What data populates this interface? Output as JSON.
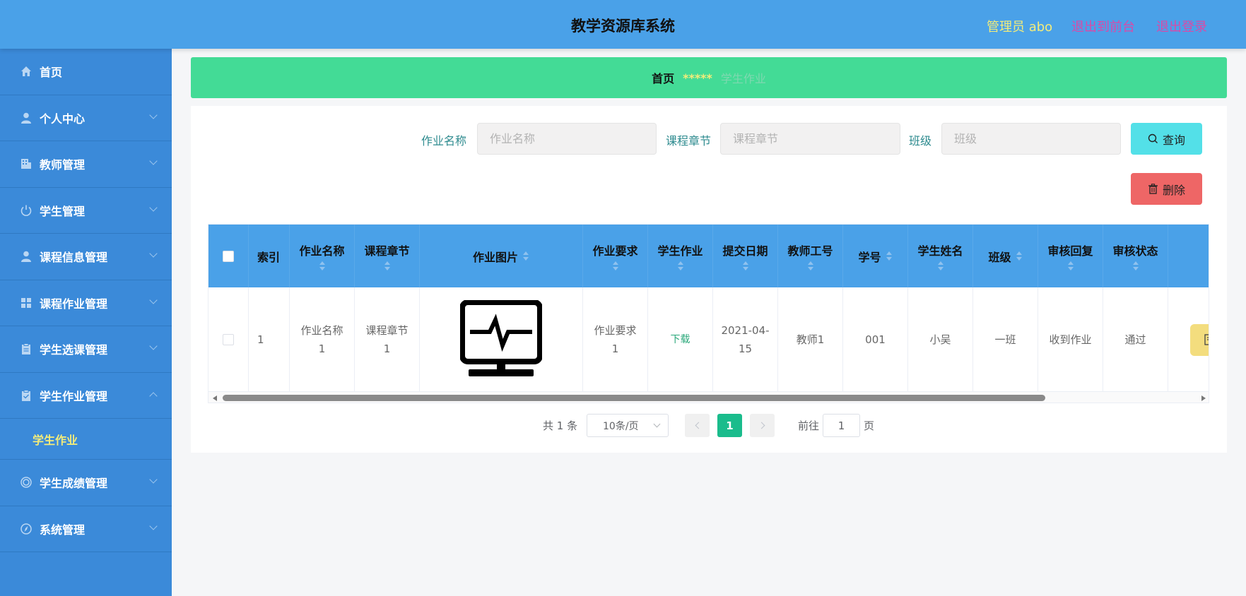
{
  "header": {
    "title": "教学资源库系统",
    "admin": "管理员 abo",
    "to_front": "退出到前台",
    "logout": "退出登录"
  },
  "sidebar": {
    "items": [
      {
        "label": "首页",
        "icon": "home-icon",
        "expanded": false,
        "has_chevron": false
      },
      {
        "label": "个人中心",
        "icon": "user-icon",
        "has_chevron": true
      },
      {
        "label": "教师管理",
        "icon": "office-icon",
        "has_chevron": true
      },
      {
        "label": "学生管理",
        "icon": "power-icon",
        "has_chevron": true
      },
      {
        "label": "课程信息管理",
        "icon": "user-icon",
        "has_chevron": true
      },
      {
        "label": "课程作业管理",
        "icon": "grid-icon",
        "has_chevron": true
      },
      {
        "label": "学生选课管理",
        "icon": "clipboard-icon",
        "has_chevron": true
      },
      {
        "label": "学生作业管理",
        "icon": "clipboard-check-icon",
        "has_chevron": true,
        "expanded": true
      },
      {
        "label": "学生成绩管理",
        "icon": "ring-icon",
        "has_chevron": true
      },
      {
        "label": "系统管理",
        "icon": "compass-icon",
        "has_chevron": true
      }
    ],
    "active_sub": "学生作业"
  },
  "breadcrumb": {
    "home": "首页",
    "sep": "*****",
    "current": "学生作业"
  },
  "search": {
    "label1": "作业名称",
    "placeholder1": "作业名称",
    "label2": "课程章节",
    "placeholder2": "课程章节",
    "label3": "班级",
    "placeholder3": "班级",
    "query_label": "查询",
    "delete_label": "删除"
  },
  "table": {
    "headers": {
      "index": "索引",
      "name": "作业名称",
      "chapter": "课程章节",
      "image": "作业图片",
      "req": "作业要求",
      "hw": "学生作业",
      "date": "提交日期",
      "teacher": "教师工号",
      "sid": "学号",
      "sname": "学生姓名",
      "class": "班级",
      "reply": "审核回复",
      "status": "审核状态"
    },
    "row": {
      "index": "1",
      "name": "作业名称1",
      "chapter": "课程章节1",
      "req": "作业要求1",
      "hw": "下载",
      "date": "2021-04-15",
      "teacher": "教师1",
      "sid": "001",
      "sname": "小吴",
      "class": "一班",
      "reply": "收到作业",
      "status": "通过"
    }
  },
  "pagination": {
    "total": "共 1 条",
    "size": "10条/页",
    "current": "1",
    "goto": "前往",
    "goto_value": "1",
    "page": "页"
  },
  "colors": {
    "header": "#4aa1e8",
    "sidebar": "#3b8ad9",
    "breadcrumb": "#43db96",
    "query": "#53e0e8",
    "delete": "#ee6666",
    "active_page": "#1abc8c"
  }
}
